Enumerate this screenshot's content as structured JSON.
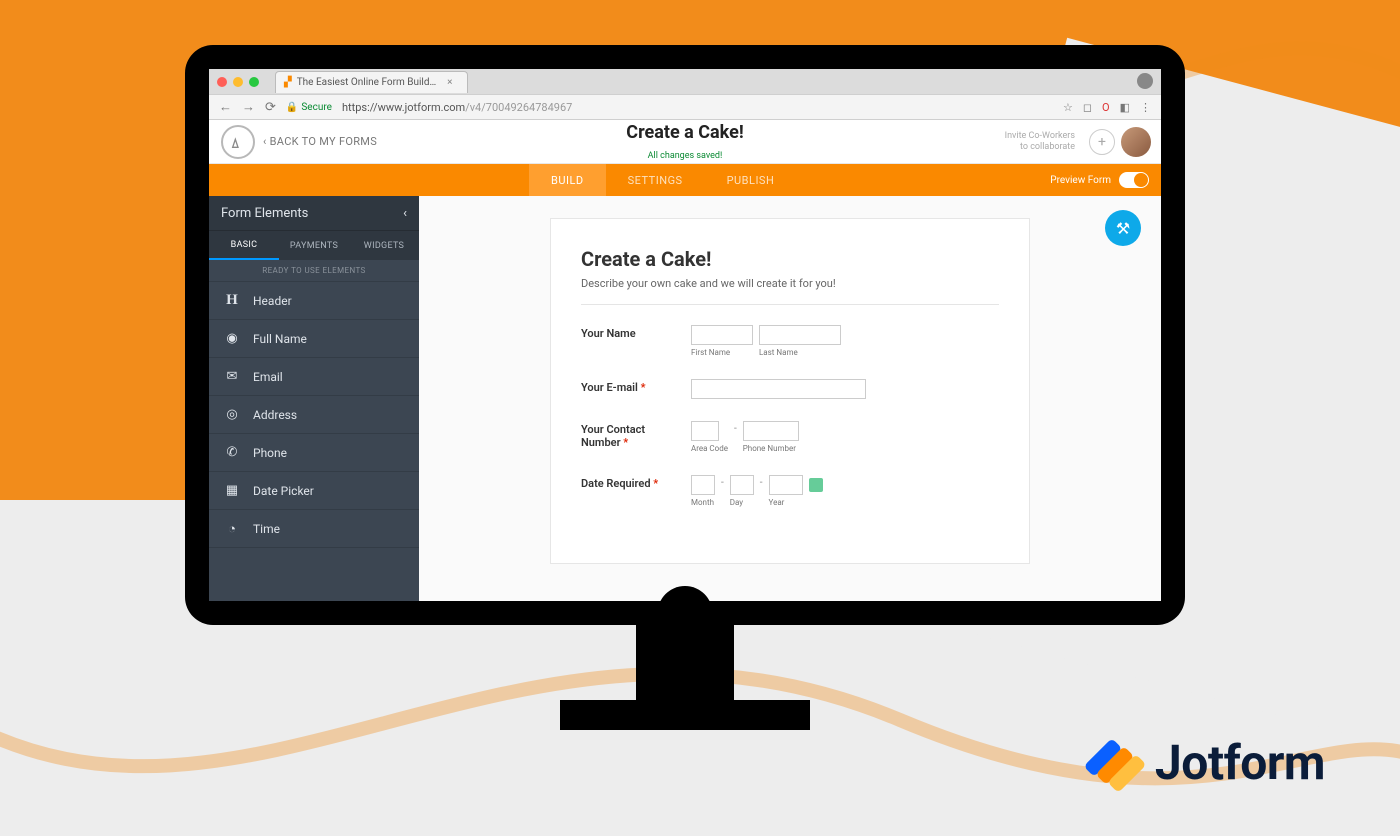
{
  "browser": {
    "tab_title": "The Easiest Online Form Build…",
    "dots": [
      "#ff5f57",
      "#febc2e",
      "#28c840"
    ],
    "secure_label": "Secure",
    "url_host": "https://www.jotform.com",
    "url_path": "/v4/70049264784967",
    "icons": {
      "back": "←",
      "fwd": "→",
      "reload": "⟳",
      "star": "☆",
      "square": "◻",
      "opera": "O",
      "ext": "◧",
      "menu": "⋮"
    }
  },
  "app_header": {
    "back_label": "BACK TO MY FORMS",
    "back_caret": "‹",
    "title": "Create a Cake!",
    "saved": "All changes saved!",
    "invite_l1": "Invite Co-Workers",
    "invite_l2": "to collaborate",
    "plus": "+"
  },
  "main_tabs": {
    "build": "BUILD",
    "settings": "SETTINGS",
    "publish": "PUBLISH",
    "preview_label": "Preview Form"
  },
  "sidebar": {
    "title": "Form Elements",
    "collapse": "‹",
    "tabs": {
      "basic": "BASIC",
      "payments": "PAYMENTS",
      "widgets": "WIDGETS"
    },
    "ready_hdr": "READY TO USE ELEMENTS",
    "items": [
      {
        "icon": "H",
        "label": "Header",
        "style": "serif"
      },
      {
        "icon": "◉",
        "label": "Full Name"
      },
      {
        "icon": "✉",
        "label": "Email"
      },
      {
        "icon": "◎",
        "label": "Address"
      },
      {
        "icon": "✆",
        "label": "Phone"
      },
      {
        "icon": "▦",
        "label": "Date Picker"
      },
      {
        "icon": "◔",
        "label": "Time"
      }
    ]
  },
  "form": {
    "title": "Create a Cake!",
    "subtitle": "Describe your own cake and we will create it for you!",
    "name_label": "Your Name",
    "first_name": "First Name",
    "last_name": "Last Name",
    "email_label": "Your E-mail",
    "contact_label_l1": "Your Contact",
    "contact_label_l2": "Number",
    "area": "Area Code",
    "phone": "Phone Number",
    "date_label": "Date Required",
    "month": "Month",
    "day": "Day",
    "year": "Year"
  },
  "brand": {
    "name": "Jotform"
  }
}
